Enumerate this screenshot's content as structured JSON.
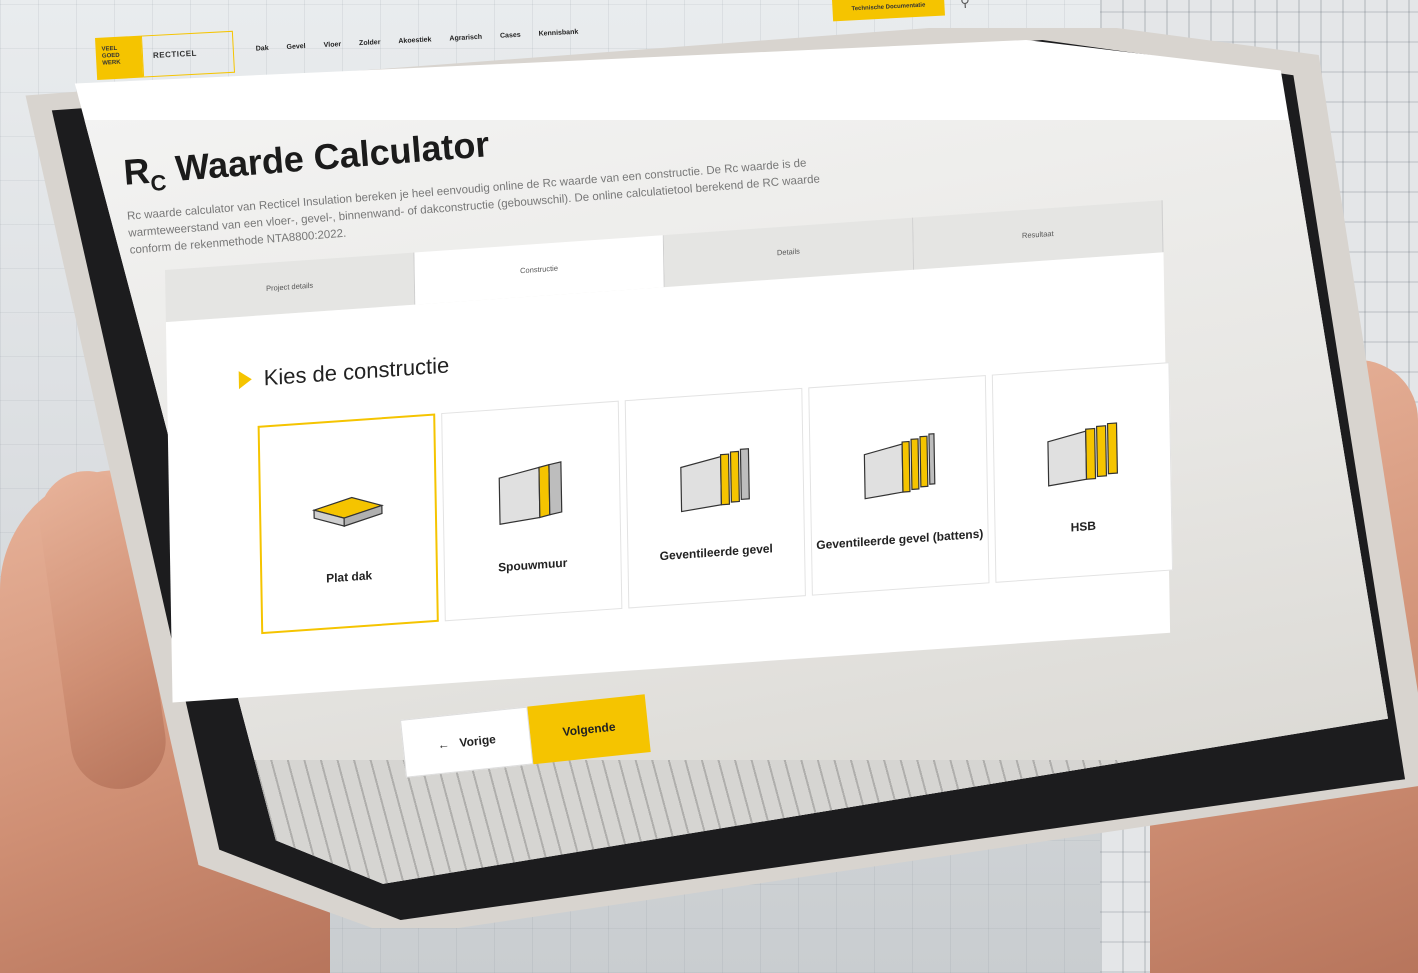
{
  "header": {
    "logo_tag": "VEEL GOED WERK",
    "logo_brand": "RECTICEL",
    "nav": [
      "Dak",
      "Gevel",
      "Vloer",
      "Zolder",
      "Akoestiek",
      "Agrarisch",
      "Cases",
      "Kennisbank"
    ],
    "tech_button": "Technische Documentatie",
    "search_icon": "search-icon"
  },
  "hero": {
    "title_main": "R",
    "title_sub": "C",
    "title_rest": " Waarde Calculator",
    "description": "Rc waarde calculator van Recticel Insulation bereken je heel eenvoudig online de Rc waarde van een constructie. De Rc waarde is de warmteweerstand van een vloer-, gevel-, binnenwand- of dakconstructie (gebouwschil). De online calculatietool berekend de RC waarde conform de rekenmethode NTA8800:2022."
  },
  "wizard": {
    "steps": [
      "Project details",
      "Constructie",
      "Details",
      "Resultaat"
    ],
    "active_step": 1,
    "section_title": "Kies de constructie",
    "options": [
      {
        "label": "Plat dak",
        "icon": "flat-roof-icon",
        "selected": true
      },
      {
        "label": "Spouwmuur",
        "icon": "cavity-wall-icon",
        "selected": false
      },
      {
        "label": "Geventileerde gevel",
        "icon": "ventilated-facade-icon",
        "selected": false
      },
      {
        "label": "Geventileerde gevel (battens)",
        "icon": "ventilated-facade-battens-icon",
        "selected": false
      },
      {
        "label": "HSB",
        "icon": "timber-frame-icon",
        "selected": false
      }
    ],
    "prev_label": "Vorige",
    "next_label": "Volgende"
  },
  "colors": {
    "accent": "#f5c400",
    "text": "#222222"
  }
}
